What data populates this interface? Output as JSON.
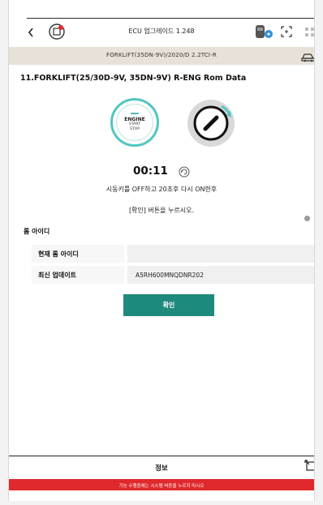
{
  "header": {
    "title": "ECU 업그레이드 1.248",
    "back_symbol": "‹"
  },
  "vehicle": {
    "text": "FORKLIFT(35DN-9V)/2020/D 2.2TCI-R"
  },
  "section_title": "11.FORKLIFT(25/30D-9V, 35DN-9V) R-ENG Rom Data",
  "engine_button": {
    "line1": "ENGINE",
    "line2": "START",
    "line3": "STOP"
  },
  "timer": "00:11",
  "messages": {
    "line1": "시동키를 OFF하고 20초후 다시 ON한후",
    "line2": "[확인] 버튼을 누르시오."
  },
  "rom": {
    "section_label": "롬 아이디",
    "current_label": "현재 롬 아이디",
    "current_value": "",
    "latest_label": "최신 업데이트",
    "latest_value": "A5RH600MNQDNR202"
  },
  "confirm_label": "확인",
  "footer": {
    "info_label": "정보",
    "warning": "기능 수행중에는 시스템 버튼을 누르지 마시오"
  },
  "colors": {
    "accent": "#1e8a7d",
    "engine_ring": "#52c6c1",
    "vehicle_bar": "#e8e1d7",
    "warning": "#e0292c"
  }
}
